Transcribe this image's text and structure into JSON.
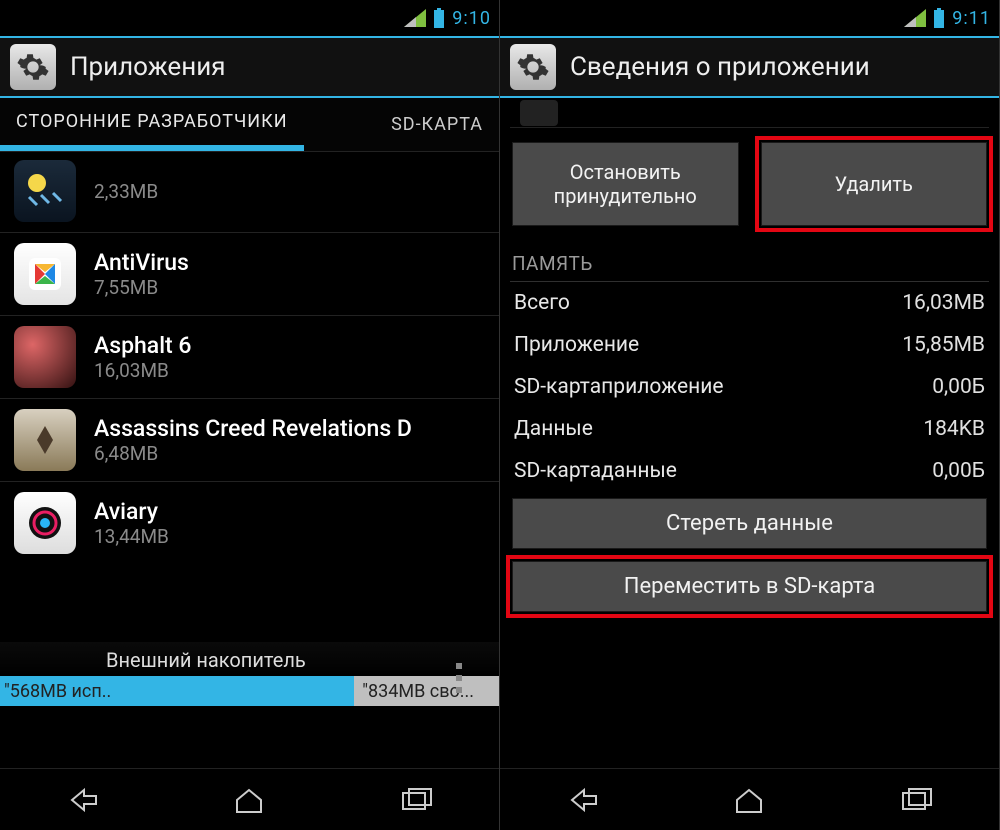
{
  "left": {
    "status": {
      "time": "9:10"
    },
    "header": {
      "title": "Приложения"
    },
    "tabs": {
      "active": "СТОРОННИЕ РАЗРАБОТЧИКИ",
      "second": "SD-КАРТА"
    },
    "apps": [
      {
        "name": "",
        "size": "2,33MB",
        "icon_bg": "linear-gradient(#1b2a3a,#0a1420)",
        "icon_hint": "weather"
      },
      {
        "name": "AntiVirus",
        "size": "7,55MB",
        "icon_bg": "linear-gradient(#fff,#e4e4e4)",
        "icon_hint": "avg"
      },
      {
        "name": "Asphalt 6",
        "size": "16,03MB",
        "icon_bg": "#111",
        "icon_hint": "asphalt"
      },
      {
        "name": "Assassins Creed Revelations D",
        "size": "6,48MB",
        "icon_bg": "linear-gradient(#d8d0c0,#a89878)",
        "icon_hint": "assassin"
      },
      {
        "name": "Aviary",
        "size": "13,44MB",
        "icon_bg": "linear-gradient(#fff,#ddd)",
        "icon_hint": "aviary"
      }
    ],
    "storage": {
      "label": "Внешний накопитель",
      "used": "568MB исп..",
      "free": "834MB сво..."
    }
  },
  "right": {
    "status": {
      "time": "9:11"
    },
    "header": {
      "title": "Сведения о приложении"
    },
    "buttons": {
      "force_stop": "Остановить принудительно",
      "uninstall": "Удалить"
    },
    "memory": {
      "section": "ПАМЯТЬ",
      "rows": [
        {
          "k": "Всего",
          "v": "16,03MB"
        },
        {
          "k": "Приложение",
          "v": "15,85MB"
        },
        {
          "k": "SD-картаприложение",
          "v": "0,00Б"
        },
        {
          "k": "Данные",
          "v": "184KB"
        },
        {
          "k": "SD-картаданные",
          "v": "0,00Б"
        }
      ],
      "clear": "Стереть данные",
      "move": "Переместить в SD-карта"
    }
  }
}
